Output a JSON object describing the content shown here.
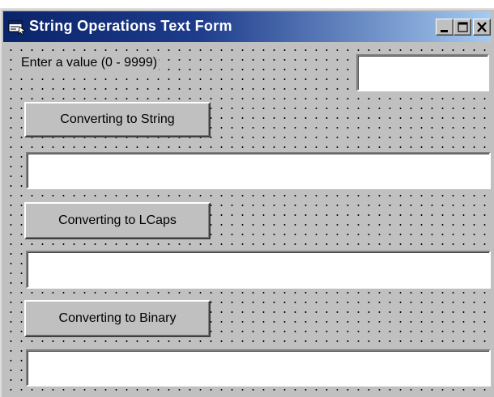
{
  "window": {
    "title": "String Operations Text Form",
    "icon": "form-icon",
    "controls": [
      "minimize-icon",
      "maximize-icon",
      "close-icon"
    ]
  },
  "form": {
    "input_label": "Enter a value (0 - 9999)",
    "input_value": "",
    "buttons": {
      "to_string": "Converting to String",
      "to_lcaps": "Converting to LCaps",
      "to_binary": "Converting to Binary"
    },
    "outputs": {
      "string_value": "",
      "lcaps_value": "",
      "binary_value": ""
    }
  },
  "colors": {
    "title_start": "#0a246a",
    "title_end": "#a6caf0",
    "face": "#c0c0c0"
  }
}
